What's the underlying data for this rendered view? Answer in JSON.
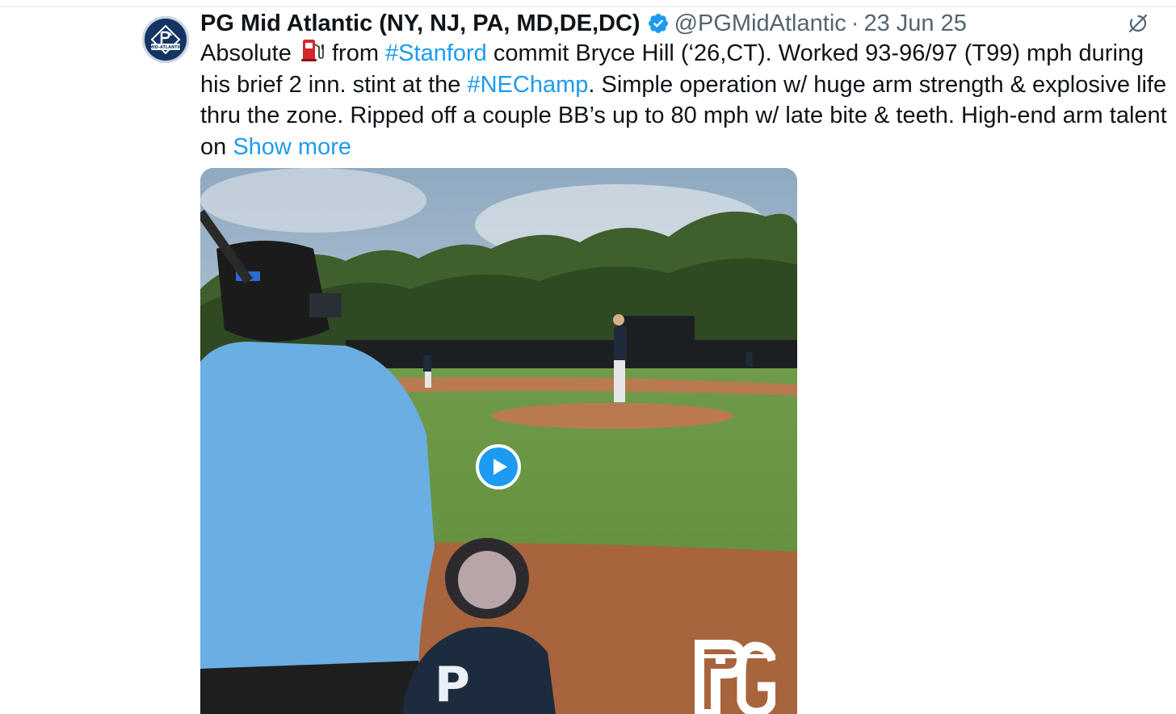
{
  "tweet": {
    "author": {
      "display_name": "PG Mid Atlantic (NY, NJ, PA, MD,DE,DC)",
      "handle": "@PGMidAtlantic",
      "verified": true,
      "avatar_icon": "pg-mid-atlantic-logo-icon",
      "avatar_text": "MID-ATLANTIC"
    },
    "separator": "·",
    "timestamp": "23 Jun 25",
    "text": {
      "part1": "Absolute ",
      "emoji_icon": "fuel-pump-icon",
      "part2": " from ",
      "hashtag1": "#Stanford",
      "part3": " commit Bryce Hill (‘26,CT). Worked 93-96/97 (T99) mph during his brief 2 inn. stint at the ",
      "hashtag2": "#NEChamp",
      "part4": ". Simple operation w/ huge arm strength & explosive life thru the zone. Ripped off a couple BB’s up to 80 mph w/ late bite & teeth. High-end arm talent on ",
      "show_more": "Show more"
    },
    "media": {
      "type": "video",
      "play_icon": "play-icon",
      "watermark_icon": "pg-logo-watermark-icon"
    }
  },
  "colors": {
    "link": "#1d9bf0",
    "secondary_text": "#536471",
    "primary_text": "#0f1419",
    "verified_badge": "#1d9bf0"
  }
}
